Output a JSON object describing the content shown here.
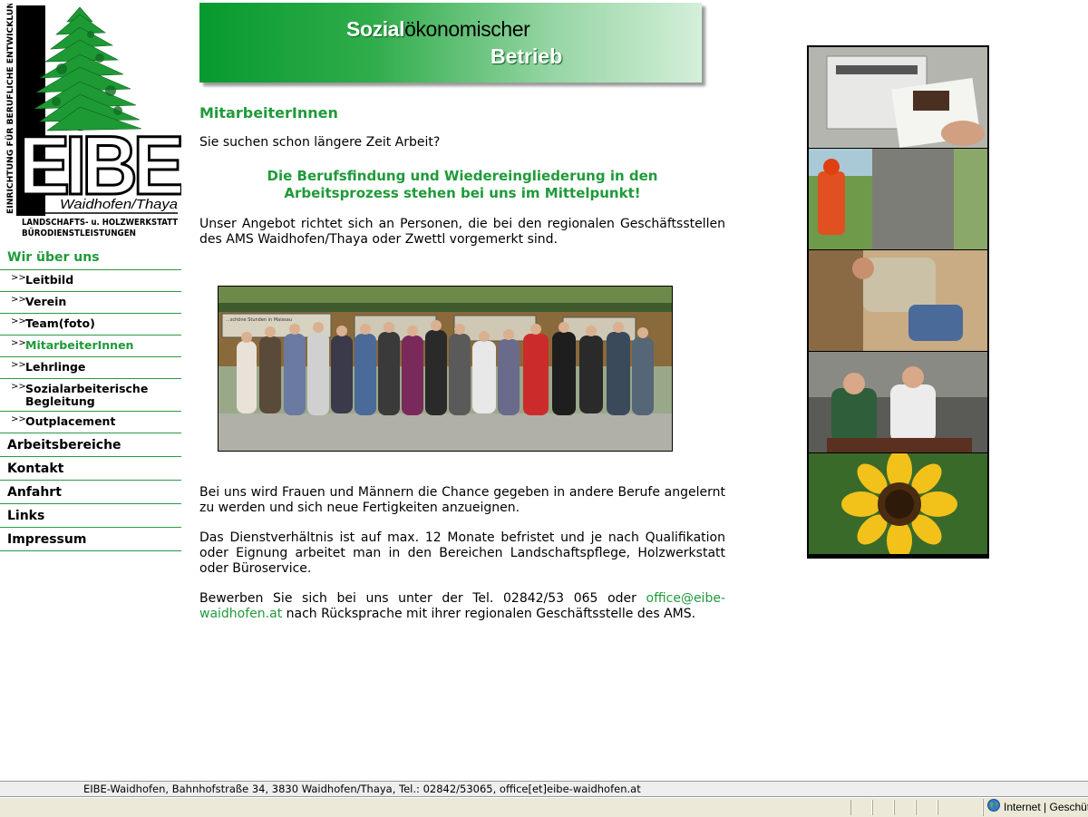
{
  "logo": {
    "side_text": "EINRICHTUNG FÜR BERUFLICHE ENTWICKLUNG",
    "brand": "EIBE",
    "location": "Waidhofen/Thaya",
    "line1": "LANDSCHAFTS- u. HOLZWERKSTATT",
    "line2": "BÜRODIENSTLEISTUNGEN"
  },
  "banner": {
    "bold": "Sozial",
    "rest": "ökonomischer",
    "line2": "Betrieb"
  },
  "nav": {
    "section": "Wir über uns",
    "arrow": ">>",
    "subitems": [
      {
        "label": "Leitbild"
      },
      {
        "label": "Verein"
      },
      {
        "label": "Team(foto)"
      },
      {
        "label": "MitarbeiterInnen",
        "active": true
      },
      {
        "label": "Lehrlinge"
      },
      {
        "label": "Sozialarbeiterische Begleitung"
      },
      {
        "label": "Outplacement"
      }
    ],
    "main": [
      {
        "label": "Arbeitsbereiche"
      },
      {
        "label": "Kontakt"
      },
      {
        "label": "Anfahrt"
      },
      {
        "label": "Links"
      },
      {
        "label": "Impressum"
      }
    ]
  },
  "content": {
    "title": "MitarbeiterInnen",
    "intro": "Sie suchen schon längere Zeit Arbeit?",
    "lead": "Die Berufsfindung und Wiedereingliederung in den Arbeitsprozess stehen bei uns im Mittelpunkt!",
    "p1": "Unser Angebot richtet sich an Personen, die bei den regionalen Geschäftsstellen des AMS Waidhofen/Thaya oder Zwettl vorgemerkt sind.",
    "p2": "Bei uns wird Frauen und Männern die Chance gegeben in andere Berufe angelernt zu werden und sich neue Fertigkeiten anzueignen.",
    "p3": "Das Dienstverhältnis ist auf max. 12 Monate befristet und je nach Qualifikation oder Eignung arbeitet man in den Bereichen Landschaftspflege, Holzwerkstatt oder Büroservice.",
    "p4_before": "Bewerben Sie sich bei uns unter der Tel. 02842/53 065 oder ",
    "p4_link": "office@eibe-waidhofen.at",
    "p4_after": " nach Rücksprache mit ihrer regionalen Geschäftsstelle des AMS."
  },
  "photo_sign": "...schöne Stunden in Maissau",
  "footer": {
    "text": "EIBE-Waidhofen, Bahnhofstraße 34, 3830 Waidhofen/Thaya, Tel.: 02842/53065, office[et]eibe-waidhofen.at"
  },
  "statusbar": {
    "zone": "Internet | Geschützter Modus: Aktiv"
  }
}
